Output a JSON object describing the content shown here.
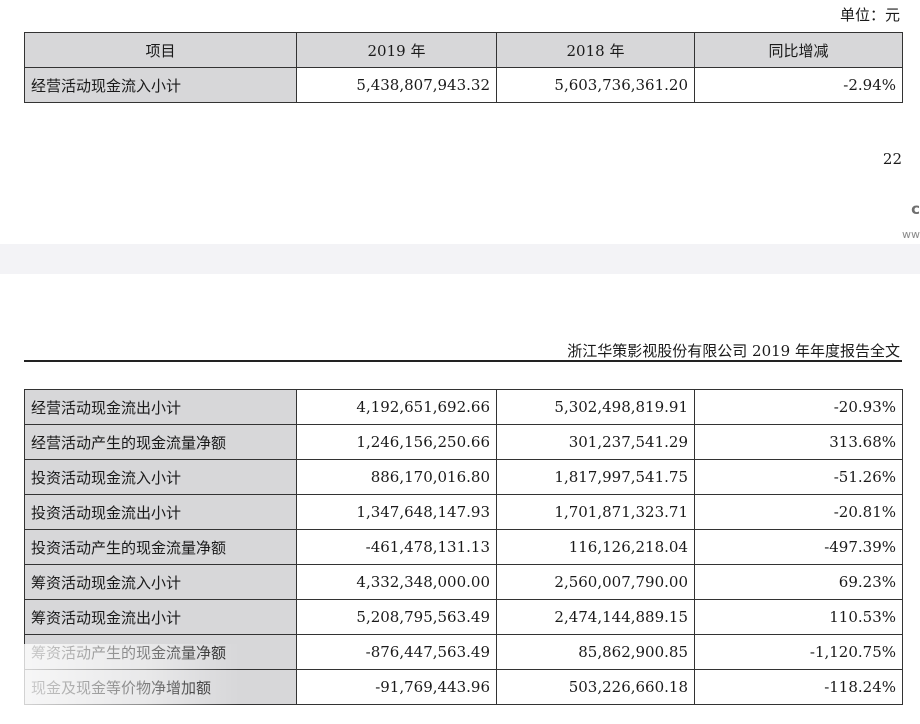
{
  "unit_label": "单位：元",
  "top_table": {
    "headers": [
      "项目",
      "2019 年",
      "2018 年",
      "同比增减"
    ],
    "rows": [
      {
        "label": "经营活动现金流入小计",
        "y2019": "5,438,807,943.32",
        "y2018": "5,603,736,361.20",
        "change": "-2.94%"
      }
    ]
  },
  "page_number": "22",
  "watermark": {
    "line1": "c",
    "line2": "ww"
  },
  "doc_header": "浙江华策影视股份有限公司 2019 年年度报告全文",
  "bottom_table": {
    "rows": [
      {
        "label": "经营活动现金流出小计",
        "y2019": "4,192,651,692.66",
        "y2018": "5,302,498,819.91",
        "change": "-20.93%"
      },
      {
        "label": "经营活动产生的现金流量净额",
        "y2019": "1,246,156,250.66",
        "y2018": "301,237,541.29",
        "change": "313.68%"
      },
      {
        "label": "投资活动现金流入小计",
        "y2019": "886,170,016.80",
        "y2018": "1,817,997,541.75",
        "change": "-51.26%"
      },
      {
        "label": "投资活动现金流出小计",
        "y2019": "1,347,648,147.93",
        "y2018": "1,701,871,323.71",
        "change": "-20.81%"
      },
      {
        "label": "投资活动产生的现金流量净额",
        "y2019": "-461,478,131.13",
        "y2018": "116,126,218.04",
        "change": "-497.39%"
      },
      {
        "label": "筹资活动现金流入小计",
        "y2019": "4,332,348,000.00",
        "y2018": "2,560,007,790.00",
        "change": "69.23%"
      },
      {
        "label": "筹资活动现金流出小计",
        "y2019": "5,208,795,563.49",
        "y2018": "2,474,144,889.15",
        "change": "110.53%"
      },
      {
        "label": "筹资活动产生的现金流量净额",
        "y2019": "-876,447,563.49",
        "y2018": "85,862,900.85",
        "change": "-1,120.75%"
      },
      {
        "label": "现金及现金等价物净增加额",
        "y2019": "-91,769,443.96",
        "y2018": "503,226,660.18",
        "change": "-118.24%"
      }
    ]
  }
}
